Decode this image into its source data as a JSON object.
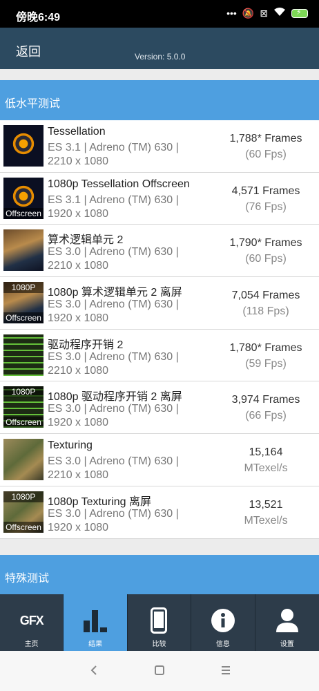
{
  "status_bar": {
    "time": "傍晚6:49"
  },
  "app_bar": {
    "back_label": "返回",
    "version": "Version: 5.0.0"
  },
  "sections": {
    "low_level": "低水平测试",
    "special": "特殊测试"
  },
  "tests": [
    {
      "name": "Tessellation",
      "desc": "ES 3.1 | Adreno (TM) 630 | 2210 x 1080",
      "result": "1,788* Frames",
      "sub": "(60 Fps)",
      "thumb": "tessellation",
      "badge_top": "",
      "badge_bottom": ""
    },
    {
      "name": "1080p Tessellation Offscreen",
      "desc": "ES 3.1 | Adreno (TM) 630 | 1920 x 1080",
      "result": "4,571 Frames",
      "sub": "(76 Fps)",
      "thumb": "tessellation",
      "badge_top": "",
      "badge_bottom": "Offscreen"
    },
    {
      "name": "算术逻辑单元 2",
      "desc": "ES 3.0 | Adreno (TM) 630 | 2210 x 1080",
      "result": "1,790* Frames",
      "sub": "(60 Fps)",
      "thumb": "alu",
      "badge_top": "",
      "badge_bottom": ""
    },
    {
      "name": "1080p 算术逻辑单元 2 离屏",
      "desc": "ES 3.0 | Adreno (TM) 630 | 1920 x 1080",
      "result": "7,054 Frames",
      "sub": "(118 Fps)",
      "thumb": "alu",
      "badge_top": "1080P",
      "badge_bottom": "Offscreen"
    },
    {
      "name": "驱动程序开销 2",
      "desc": "ES 3.0 | Adreno (TM) 630 | 2210 x 1080",
      "result": "1,780* Frames",
      "sub": "(59 Fps)",
      "thumb": "driver",
      "badge_top": "",
      "badge_bottom": ""
    },
    {
      "name": "1080p 驱动程序开销 2 离屏",
      "desc": "ES 3.0 | Adreno (TM) 630 | 1920 x 1080",
      "result": "3,974 Frames",
      "sub": "(66 Fps)",
      "thumb": "driver",
      "badge_top": "1080P",
      "badge_bottom": "Offscreen"
    },
    {
      "name": "Texturing",
      "desc": "ES 3.0 | Adreno (TM) 630 | 2210 x 1080",
      "result": "15,164",
      "sub": "MTexel/s",
      "thumb": "texturing",
      "badge_top": "",
      "badge_bottom": ""
    },
    {
      "name": "1080p Texturing 离屏",
      "desc": "ES 3.0 | Adreno (TM) 630 | 1920 x 1080",
      "result": "13,521",
      "sub": "MTexel/s",
      "thumb": "texturing",
      "badge_top": "1080P",
      "badge_bottom": "Offscreen"
    }
  ],
  "nav": [
    {
      "label": "主页",
      "icon": "gfx-logo-icon",
      "logo_text": "GFX"
    },
    {
      "label": "结果",
      "icon": "bar-chart-icon",
      "active": true
    },
    {
      "label": "比较",
      "icon": "phone-icon"
    },
    {
      "label": "信息",
      "icon": "info-icon"
    },
    {
      "label": "设置",
      "icon": "user-icon"
    }
  ],
  "colors": {
    "appbar": "#2c4a60",
    "section": "#4e9fe0",
    "navbar": "#2d3c4a",
    "nav_active": "#4e9fe0"
  }
}
